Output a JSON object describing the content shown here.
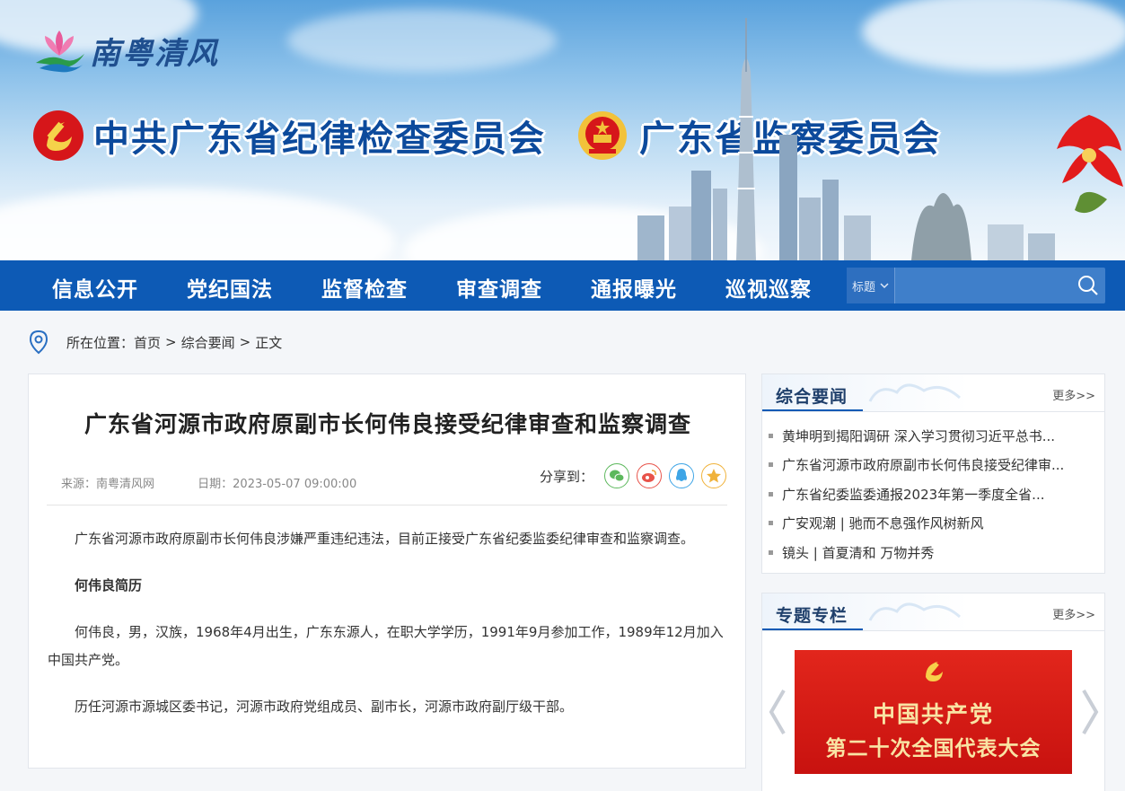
{
  "header": {
    "logo_text": "南粤清风",
    "org_left": "中共广东省纪律检查委员会",
    "org_right": "广东省监察委员会"
  },
  "nav": {
    "items": [
      {
        "label": "信息公开"
      },
      {
        "label": "党纪国法"
      },
      {
        "label": "监督检查"
      },
      {
        "label": "审查调查"
      },
      {
        "label": "通报曝光"
      },
      {
        "label": "巡视巡察"
      }
    ],
    "search": {
      "select_label": "标题",
      "placeholder": "",
      "value": ""
    }
  },
  "breadcrumb": {
    "prefix": "所在位置：",
    "items": [
      {
        "label": "首页"
      },
      {
        "label": "综合要闻"
      },
      {
        "label": "正文"
      }
    ],
    "separator": ">"
  },
  "article": {
    "title": "广东省河源市政府原副市长何伟良接受纪律审查和监察调查",
    "source": "来源：南粤清风网",
    "date": "日期：2023-05-07 09:00:00",
    "share_label": "分享到：",
    "share_icons": [
      "wechat-icon",
      "weibo-icon",
      "qq-icon",
      "qzone-icon"
    ],
    "paragraphs": [
      "广东省河源市政府原副市长何伟良涉嫌严重违纪违法，目前正接受广东省纪委监委纪律审查和监察调查。",
      "何伟良简历",
      "何伟良，男，汉族，1968年4月出生，广东东源人，在职大学学历，1991年9月参加工作，1989年12月加入中国共产党。",
      "历任河源市源城区委书记，河源市政府党组成员、副市长，河源市政府副厅级干部。"
    ]
  },
  "sidebar": {
    "news_panel": {
      "title": "综合要闻",
      "more": "更多>>",
      "items": [
        {
          "text": "黄坤明到揭阳调研 深入学习贯彻习近平总书..."
        },
        {
          "text": "广东省河源市政府原副市长何伟良接受纪律审..."
        },
        {
          "text": "广东省纪委监委通报2023年第一季度全省..."
        },
        {
          "text": "广安观潮 | 驰而不息强作风树新风"
        },
        {
          "text": "镜头 | 首夏清和 万物并秀"
        }
      ]
    },
    "special_panel": {
      "title": "专题专栏",
      "more": "更多>>",
      "banner_line1": "中国共产党",
      "banner_line2": "第二十次全国代表大会"
    }
  },
  "colors": {
    "nav_bg": "#0d5ab5",
    "title_blue": "#0c4a9c",
    "party_red": "#d0161a",
    "gold": "#f9e4a4"
  }
}
